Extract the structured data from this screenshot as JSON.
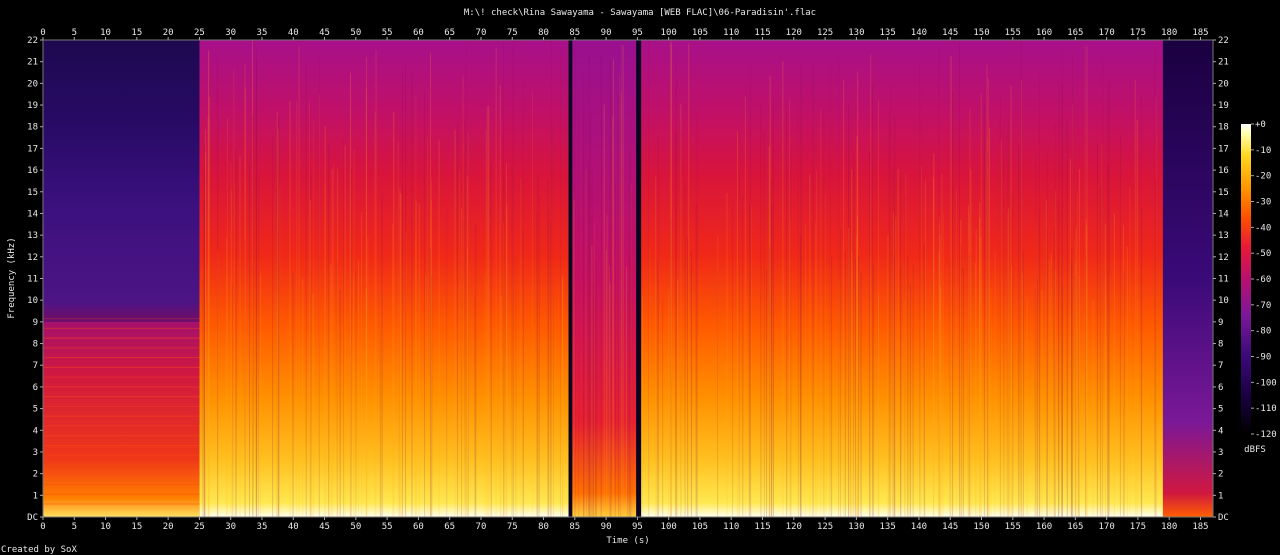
{
  "chart_data": {
    "type": "heatmap",
    "title": "M:\\! check\\Rina Sawayama - Sawayama [WEB FLAC]\\06-Paradisin'.flac",
    "xlabel": "Time (s)",
    "ylabel": "Frequency (kHz)",
    "xlim": [
      0,
      187
    ],
    "ylim": [
      0,
      22
    ],
    "x_ticks": [
      0,
      5,
      10,
      15,
      20,
      25,
      30,
      35,
      40,
      45,
      50,
      55,
      60,
      65,
      70,
      75,
      80,
      85,
      90,
      95,
      100,
      105,
      110,
      115,
      120,
      125,
      130,
      135,
      140,
      145,
      150,
      155,
      160,
      165,
      170,
      175,
      180,
      185
    ],
    "y_ticks": [
      "DC",
      "1",
      "2",
      "3",
      "4",
      "5",
      "6",
      "7",
      "8",
      "9",
      "10",
      "11",
      "12",
      "13",
      "14",
      "15",
      "16",
      "17",
      "18",
      "19",
      "20",
      "21",
      "22"
    ],
    "colorbar": {
      "label": "dBFS",
      "ticks": [
        "+0",
        "-10",
        "-20",
        "-30",
        "-40",
        "-50",
        "-60",
        "-70",
        "-80",
        "-90",
        "-100",
        "-110",
        "-120"
      ],
      "range": [
        0,
        -120
      ]
    },
    "colormap": [
      "#000000",
      "#1a0030",
      "#3a0a78",
      "#6a1a9a",
      "#a0108a",
      "#d01050",
      "#f02818",
      "#ff6a00",
      "#ffb000",
      "#ffe840",
      "#ffffc8",
      "#ffffff"
    ],
    "segments": [
      {
        "start": 0,
        "end": 25,
        "level": "quiet intro, energy below 9 kHz"
      },
      {
        "start": 25,
        "end": 84,
        "level": "full band up to 22 kHz"
      },
      {
        "start": 84,
        "end": 95,
        "level": "full band"
      },
      {
        "start": 95,
        "end": 179,
        "level": "full band up to 22 kHz"
      },
      {
        "start": 179,
        "end": 187,
        "level": "fade out"
      }
    ],
    "credit": "Created by SoX"
  }
}
